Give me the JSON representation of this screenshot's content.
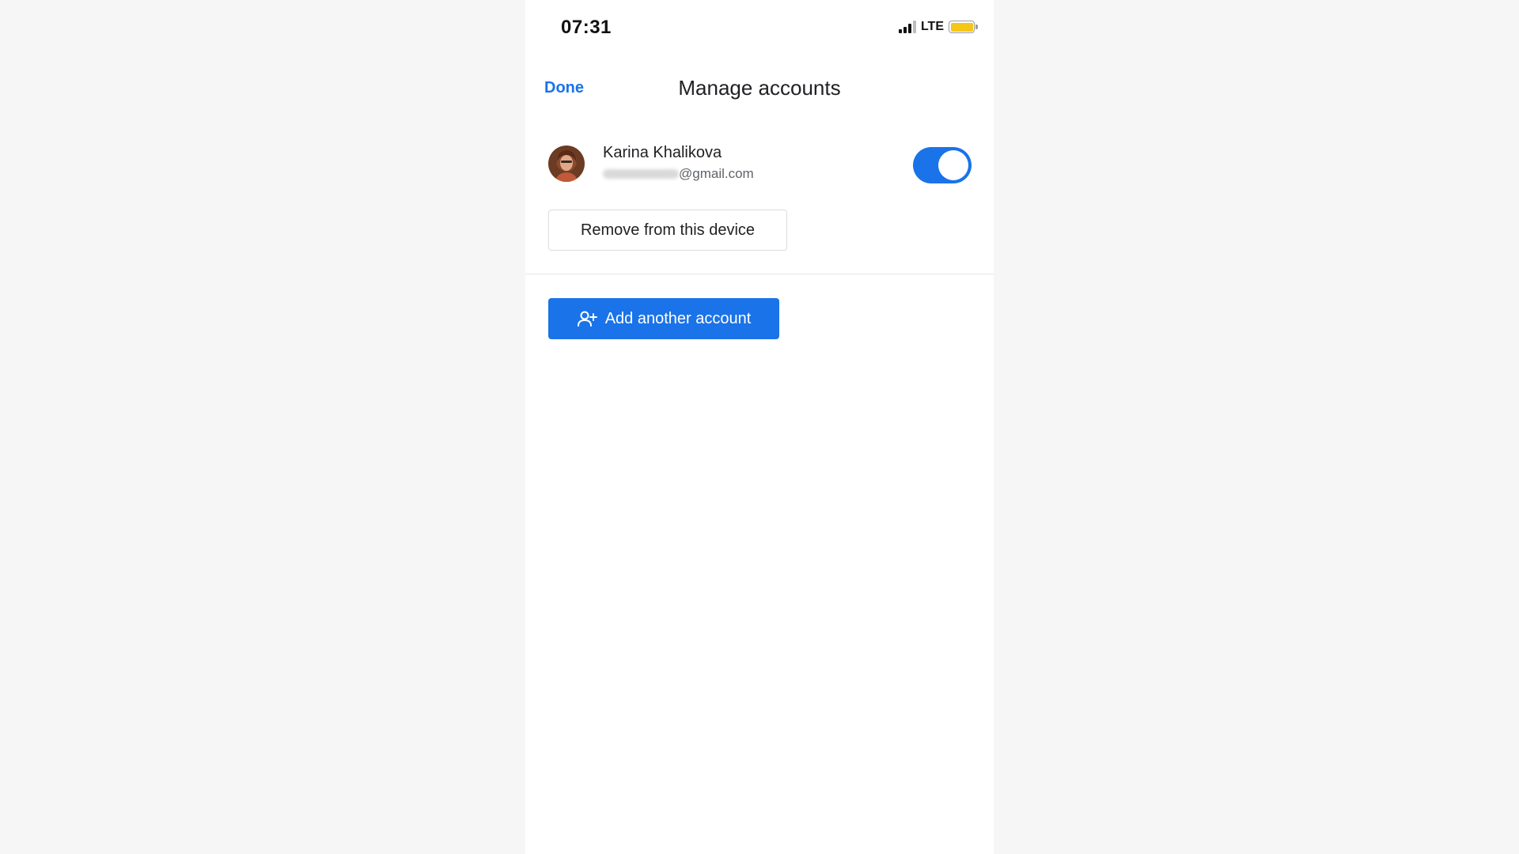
{
  "status_bar": {
    "time": "07:31",
    "network": "LTE",
    "icons": [
      "signal-icon",
      "battery-icon"
    ],
    "battery_color": "#f5c518"
  },
  "header": {
    "done_label": "Done",
    "title": "Manage accounts"
  },
  "account": {
    "name": "Karina Khalikova",
    "email_domain": "@gmail.com",
    "sync_enabled": true,
    "toggle_color": "#1a73e8"
  },
  "actions": {
    "remove_label": "Remove from this device",
    "add_account_label": "Add another account",
    "add_account_icon": "add-person-icon",
    "accent": "#1a73e8"
  }
}
